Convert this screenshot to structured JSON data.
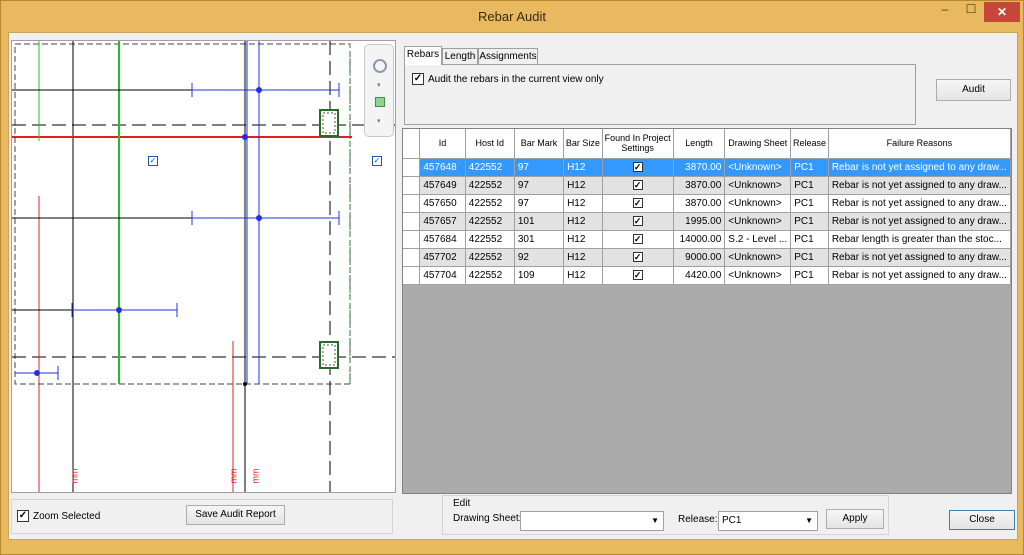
{
  "window": {
    "title": "Rebar Audit",
    "minimize_glyph": "–",
    "maximize_glyph": "☐",
    "close_glyph": "✕"
  },
  "preview": {
    "dim_label": "mm"
  },
  "tabs": [
    {
      "label": "Rebars",
      "active": true
    },
    {
      "label": "Length",
      "active": false
    },
    {
      "label": "Assignments",
      "active": false
    }
  ],
  "rebars_tab": {
    "audit_checkbox_label": "Audit the rebars in the current view only",
    "audit_checked": true
  },
  "audit_button": "Audit",
  "grid": {
    "columns": [
      "Id",
      "Host Id",
      "Bar Mark",
      "Bar Size",
      "Found In Project Settings",
      "Length",
      "Drawing Sheet",
      "Release",
      "Failure Reasons"
    ],
    "rows": [
      {
        "id": "457648",
        "host": "422552",
        "mark": "97",
        "size": "H12",
        "found": true,
        "length": "3870.00",
        "sheet": "<Unknown>",
        "release": "PC1",
        "reason": "Rebar is not yet assigned to any draw...",
        "selected": true
      },
      {
        "id": "457649",
        "host": "422552",
        "mark": "97",
        "size": "H12",
        "found": true,
        "length": "3870.00",
        "sheet": "<Unknown>",
        "release": "PC1",
        "reason": "Rebar is not yet assigned to any draw..."
      },
      {
        "id": "457650",
        "host": "422552",
        "mark": "97",
        "size": "H12",
        "found": true,
        "length": "3870.00",
        "sheet": "<Unknown>",
        "release": "PC1",
        "reason": "Rebar is not yet assigned to any draw..."
      },
      {
        "id": "457657",
        "host": "422552",
        "mark": "101",
        "size": "H12",
        "found": true,
        "length": "1995.00",
        "sheet": "<Unknown>",
        "release": "PC1",
        "reason": "Rebar is not yet assigned to any draw..."
      },
      {
        "id": "457684",
        "host": "422552",
        "mark": "301",
        "size": "H12",
        "found": true,
        "length": "14000.00",
        "sheet": "S.2 - Level ...",
        "release": "PC1",
        "reason": "Rebar length is greater than the stoc..."
      },
      {
        "id": "457702",
        "host": "422552",
        "mark": "92",
        "size": "H12",
        "found": true,
        "length": "9000.00",
        "sheet": "<Unknown>",
        "release": "PC1",
        "reason": "Rebar is not yet assigned to any draw..."
      },
      {
        "id": "457704",
        "host": "422552",
        "mark": "109",
        "size": "H12",
        "found": true,
        "length": "4420.00",
        "sheet": "<Unknown>",
        "release": "PC1",
        "reason": "Rebar is not yet assigned to any draw..."
      }
    ]
  },
  "bottom": {
    "zoom_selected_label": "Zoom Selected",
    "zoom_selected_checked": true,
    "save_report_button": "Save Audit Report",
    "edit_group_title": "Edit",
    "drawing_sheet_label": "Drawing Sheet:",
    "drawing_sheet_value": "",
    "release_label": "Release:",
    "release_value": "PC1",
    "apply_button": "Apply",
    "close_button": "Close"
  }
}
